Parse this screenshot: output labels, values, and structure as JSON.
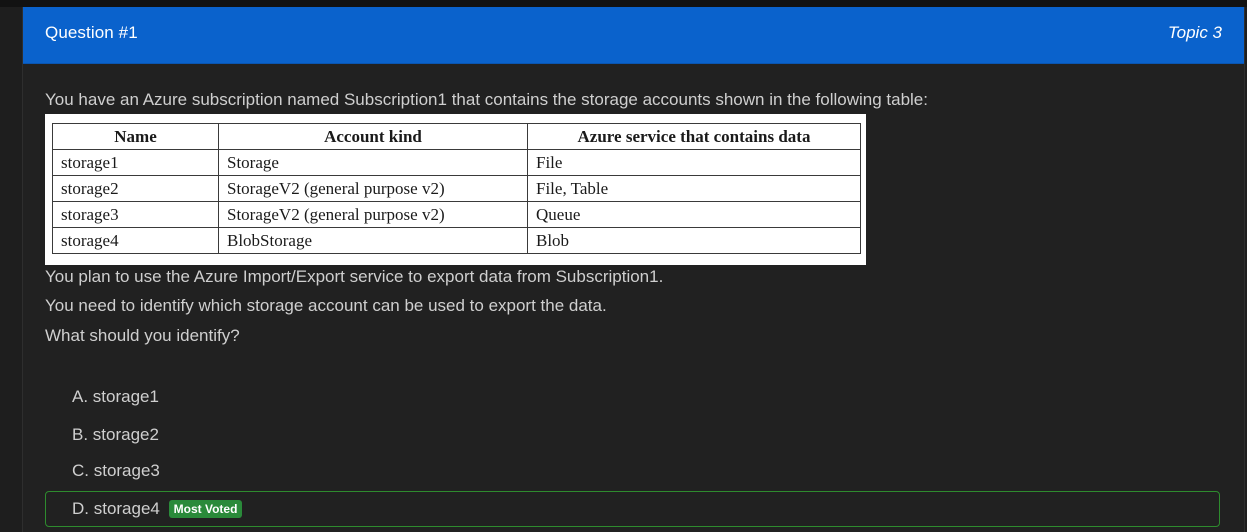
{
  "header": {
    "question_title": "Question #1",
    "topic": "Topic 3"
  },
  "question": {
    "intro": "You have an Azure subscription named Subscription1 that contains the storage accounts shown in the following table:",
    "lines": [
      "You plan to use the Azure Import/Export service to export data from Subscription1.",
      "You need to identify which storage account can be used to export the data.",
      "What should you identify?"
    ]
  },
  "table": {
    "headers": [
      "Name",
      "Account kind",
      "Azure service that contains data"
    ],
    "rows": [
      [
        "storage1",
        "Storage",
        "File"
      ],
      [
        "storage2",
        "StorageV2 (general purpose v2)",
        "File, Table"
      ],
      [
        "storage3",
        "StorageV2 (general purpose v2)",
        "Queue"
      ],
      [
        "storage4",
        "BlobStorage",
        "Blob"
      ]
    ]
  },
  "options": [
    {
      "label": "A. storage1"
    },
    {
      "label": "B. storage2"
    },
    {
      "label": "C. storage3"
    },
    {
      "label": "D. storage4",
      "badge": "Most Voted"
    }
  ],
  "colors": {
    "header_bg": "#0a62cc",
    "page_bg": "#212121",
    "most_voted_badge": "#2a8a3a",
    "selected_border": "#2e8b2e"
  }
}
